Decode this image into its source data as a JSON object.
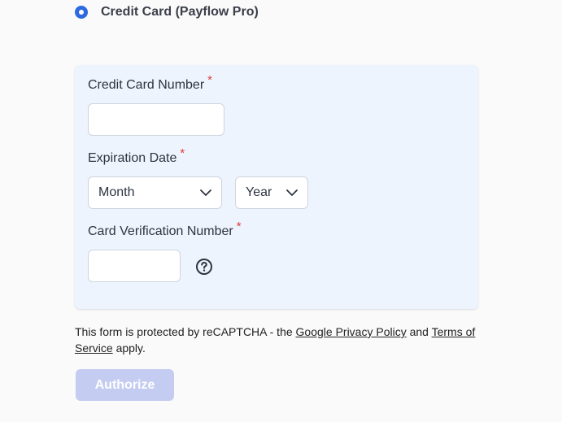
{
  "payment_method": {
    "label": "Credit Card (Payflow Pro)",
    "selected": true
  },
  "form": {
    "card_number": {
      "label": "Credit Card Number",
      "required_mark": "*",
      "value": ""
    },
    "expiration": {
      "label": "Expiration Date",
      "required_mark": "*",
      "month_value": "Month",
      "year_value": "Year"
    },
    "cvv": {
      "label": "Card Verification Number",
      "required_mark": "*",
      "value": ""
    }
  },
  "recaptcha": {
    "prefix": "This form is protected by reCAPTCHA - the ",
    "privacy_link": "Google Privacy Policy",
    "middle": " and ",
    "terms_link": "Terms of Service",
    "suffix": " apply."
  },
  "actions": {
    "authorize_label": "Authorize"
  },
  "colors": {
    "accent": "#2d6ae0",
    "panel_bg": "#edf4fd",
    "required": "#e03c3c",
    "button_disabled": "#c4ccf2"
  },
  "icons": {
    "radio": "radio-selected-icon",
    "select_arrow": "chevron-down-icon",
    "help": "question-circle-icon"
  }
}
